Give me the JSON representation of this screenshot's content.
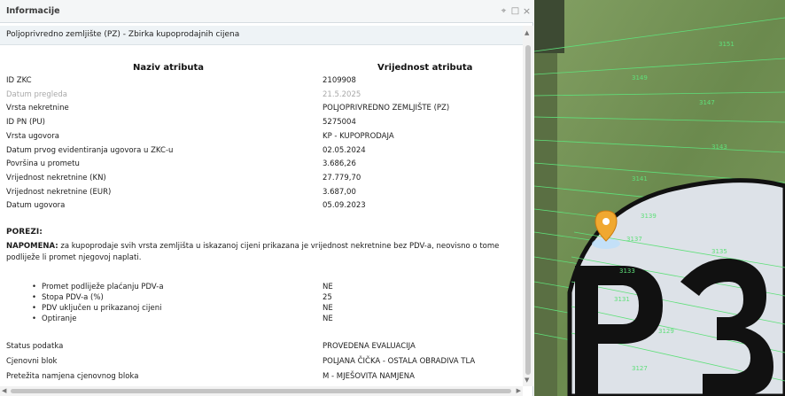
{
  "panel": {
    "title": "Informacije",
    "subtitle": "Poljoprivredno zemljište (PZ) - Zbirka kupoprodajnih cijena",
    "buttons": {
      "pin": "⌖",
      "maximize": "□",
      "close": "×"
    },
    "col_name": "Naziv atributa",
    "col_value": "Vrijednost atributa"
  },
  "attributes": [
    {
      "label": "ID ZKC",
      "value": "2109908",
      "muted": false
    },
    {
      "label": "Datum pregleda",
      "value": "21.5.2025",
      "muted": true
    },
    {
      "label": "Vrsta nekretnine",
      "value": "POLJOPRIVREDNO ZEMLJIŠTE (PZ)",
      "muted": false
    },
    {
      "label": "ID PN (PU)",
      "value": "5275004",
      "muted": false
    },
    {
      "label": "Vrsta ugovora",
      "value": "KP - KUPOPRODAJA",
      "muted": false
    },
    {
      "label": "Datum prvog evidentiranja ugovora u ZKC-u",
      "value": "02.05.2024",
      "muted": false
    },
    {
      "label": "Površina u prometu",
      "value": "3.686,26",
      "muted": false
    },
    {
      "label": "Vrijednost nekretnine (KN)",
      "value": "27.779,70",
      "muted": false
    },
    {
      "label": "Vrijednost nekretnine (EUR)",
      "value": "3.687,00",
      "muted": false
    },
    {
      "label": "Datum ugovora",
      "value": "05.09.2023",
      "muted": false
    }
  ],
  "porezi": {
    "heading": "POREZI:",
    "note_bold": "NAPOMENA:",
    "note_text": " za kupoprodaje svih vrsta zemljišta u iskazanoj cijeni prikazana je vrijednost nekretnine bez PDV-a, neovisno o tome podliježe li promet njegovoj naplati.",
    "items": [
      {
        "label": "Promet podliježe plaćanju PDV-a",
        "value": "NE"
      },
      {
        "label": "Stopa PDV-a (%)",
        "value": "25"
      },
      {
        "label": "PDV uključen u prikazanoj cijeni",
        "value": "NE"
      },
      {
        "label": "Optiranje",
        "value": "NE"
      }
    ]
  },
  "extra_attributes": [
    {
      "label": "Status podatka",
      "value": "PROVEDENA EVALUACIJA"
    },
    {
      "label": "Cjenovni blok",
      "value": "POLJANA ČIČKA - OSTALA OBRADIVA TLA"
    },
    {
      "label": "Pretežita namjena cjenovnog bloka",
      "value": "M - MJEŠOVITA NAMJENA"
    }
  ],
  "map": {
    "label": "P3",
    "parcel_labels": [
      "3151",
      "3149",
      "3147",
      "3143",
      "3141",
      "3139",
      "3137",
      "3135",
      "3133",
      "3131",
      "3129",
      "3127"
    ],
    "colors": {
      "field": "#7d9a5c",
      "parcel_line": "#5fe07a",
      "zone_fill": "#dde2e8",
      "marker": "#f0a830"
    }
  }
}
